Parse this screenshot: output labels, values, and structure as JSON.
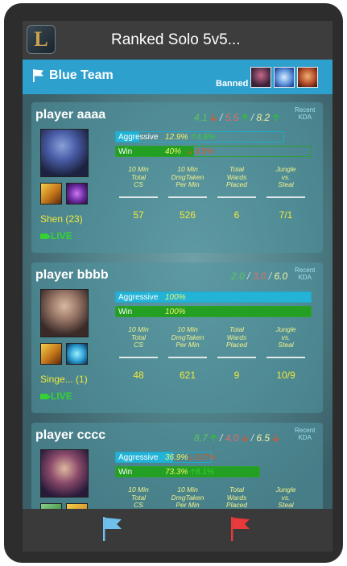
{
  "app": {
    "title": "Ranked Solo 5v5...",
    "logo_letter": "L"
  },
  "team": {
    "name": "Blue Team",
    "banned_label": "Banned",
    "banned": [
      "champion-1",
      "champion-2",
      "champion-3"
    ]
  },
  "kda_label": "Recent\nKDA",
  "stat_labels": [
    "10 Min\nTotal\nCS",
    "10 Min\nDmgTaken\nPer Min",
    "Total\nWards\nPlaced",
    "Jungle\nvs.\nSteal"
  ],
  "players": [
    {
      "name": "player aaaa",
      "kda": {
        "k": "4.1",
        "k_trend": "down",
        "d": "5.5",
        "d_trend": "up",
        "a": "8.2",
        "a_trend": "up"
      },
      "aggressive": {
        "label": "Aggressive",
        "value": "12.9%",
        "fraction": 0.129,
        "delta": "4.6%",
        "delta_trend": "up"
      },
      "win": {
        "label": "Win",
        "value": "40%",
        "fraction": 0.4,
        "delta": "-3.5%",
        "delta_trend": "down"
      },
      "stats": [
        "57",
        "526",
        "6",
        "7/1"
      ],
      "champion": "Shen (23)",
      "status": "LIVE"
    },
    {
      "name": "player bbbb",
      "kda": {
        "k": "2.0",
        "k_trend": "",
        "d": "3.0",
        "d_trend": "",
        "a": "6.0",
        "a_trend": ""
      },
      "aggressive": {
        "label": "Aggressive",
        "value": "100%",
        "fraction": 1.0,
        "delta": "",
        "delta_trend": ""
      },
      "win": {
        "label": "Win",
        "value": "100%",
        "fraction": 1.0,
        "delta": "",
        "delta_trend": ""
      },
      "stats": [
        "48",
        "621",
        "9",
        "10/9"
      ],
      "champion": "Singe... (1)",
      "status": "LIVE"
    },
    {
      "name": "player cccc",
      "kda": {
        "k": "8.7",
        "k_trend": "up",
        "d": "4.0",
        "d_trend": "down",
        "a": "6.5",
        "a_trend": "down"
      },
      "aggressive": {
        "label": "Aggressive",
        "value": "36.9%",
        "fraction": 0.369,
        "delta": "-3.7%",
        "delta_trend": "down"
      },
      "win": {
        "label": "Win",
        "value": "73.3%",
        "fraction": 0.733,
        "delta": "8.1%",
        "delta_trend": "up"
      },
      "stats": [
        "",
        "",
        "",
        ""
      ],
      "champion": "",
      "status": ""
    }
  ],
  "nav": {
    "blue_flag": "blue-team",
    "red_flag": "red-team"
  },
  "colors": {
    "team_bar": "#2ea0cd",
    "aggressive": "#22b3d6",
    "win": "#23a023",
    "stat_value": "#f2e93a",
    "live": "#34d334",
    "blue_flag": "#6fc0ec",
    "red_flag": "#e83a3a"
  }
}
